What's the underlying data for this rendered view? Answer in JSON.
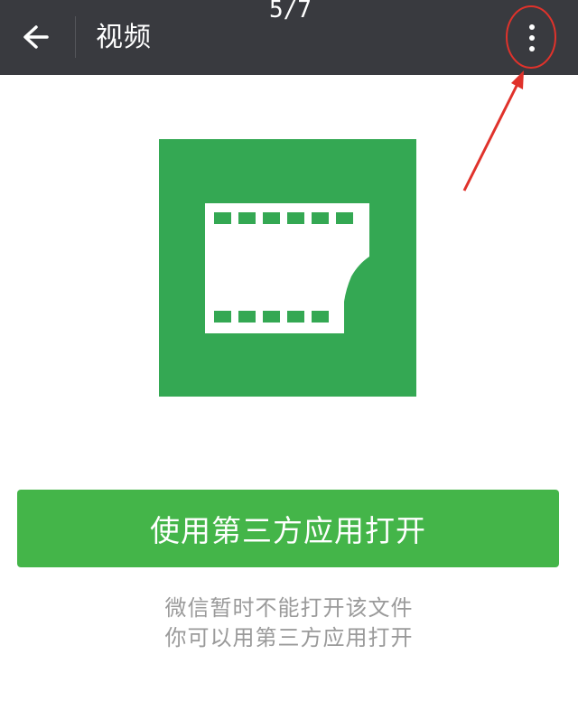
{
  "header": {
    "title": "视频",
    "counter": "5/7",
    "back_icon": "arrow-left-icon",
    "more_icon": "more-vertical-icon",
    "background": "#393a3f"
  },
  "file_preview": {
    "icon": "film-strip-icon",
    "color": "#34a853"
  },
  "action": {
    "open_label": "使用第三方应用打开",
    "color": "#44b549"
  },
  "message": {
    "line1": "微信暂时不能打开该文件",
    "line2": "你可以用第三方应用打开"
  },
  "annotation": {
    "color": "#e0322b"
  }
}
